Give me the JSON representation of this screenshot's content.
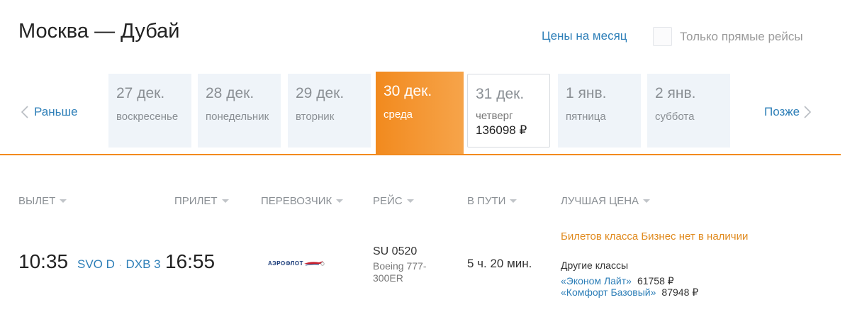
{
  "header": {
    "title": "Москва — Дубай",
    "month_prices_link": "Цены на месяц",
    "direct_only_label": "Только прямые рейсы"
  },
  "date_nav": {
    "earlier_label": "Раньше",
    "later_label": "Позже",
    "dates": [
      {
        "date": "27 дек.",
        "weekday": "воскресенье"
      },
      {
        "date": "28 дек.",
        "weekday": "понедельник"
      },
      {
        "date": "29 дек.",
        "weekday": "вторник"
      },
      {
        "date": "30 дек.",
        "weekday": "среда",
        "selected": true
      },
      {
        "date": "31 дек.",
        "weekday": "четверг",
        "price": "136098 ₽"
      },
      {
        "date": "1 янв.",
        "weekday": "пятница"
      },
      {
        "date": "2 янв.",
        "weekday": "суббота"
      }
    ]
  },
  "columns": {
    "departure": "ВЫЛЕТ",
    "arrival": "ПРИЛЕТ",
    "carrier": "ПЕРЕВОЗЧИК",
    "flight": "РЕЙС",
    "duration": "В ПУТИ",
    "best_price": "ЛУЧШАЯ ЦЕНА"
  },
  "flight": {
    "departure_time": "10:35",
    "origin": "SVO D",
    "destination": "DXB 3",
    "arrival_time": "16:55",
    "airline_logo_text": "АЭРОФЛОТ",
    "flight_number": "SU 0520",
    "aircraft": "Boeing 777-300ER",
    "duration": "5 ч. 20 мин.",
    "business_unavailable": "Билетов класса Бизнес нет в наличии",
    "other_classes_label": "Другие классы",
    "fares": [
      {
        "name": "«Эконом Лайт»",
        "price": "61758 ₽"
      },
      {
        "name": "«Комфорт Базовый»",
        "price": "87948 ₽"
      }
    ]
  },
  "colors": {
    "accent_orange": "#f28a1e",
    "link_blue": "#2e7fb8"
  }
}
